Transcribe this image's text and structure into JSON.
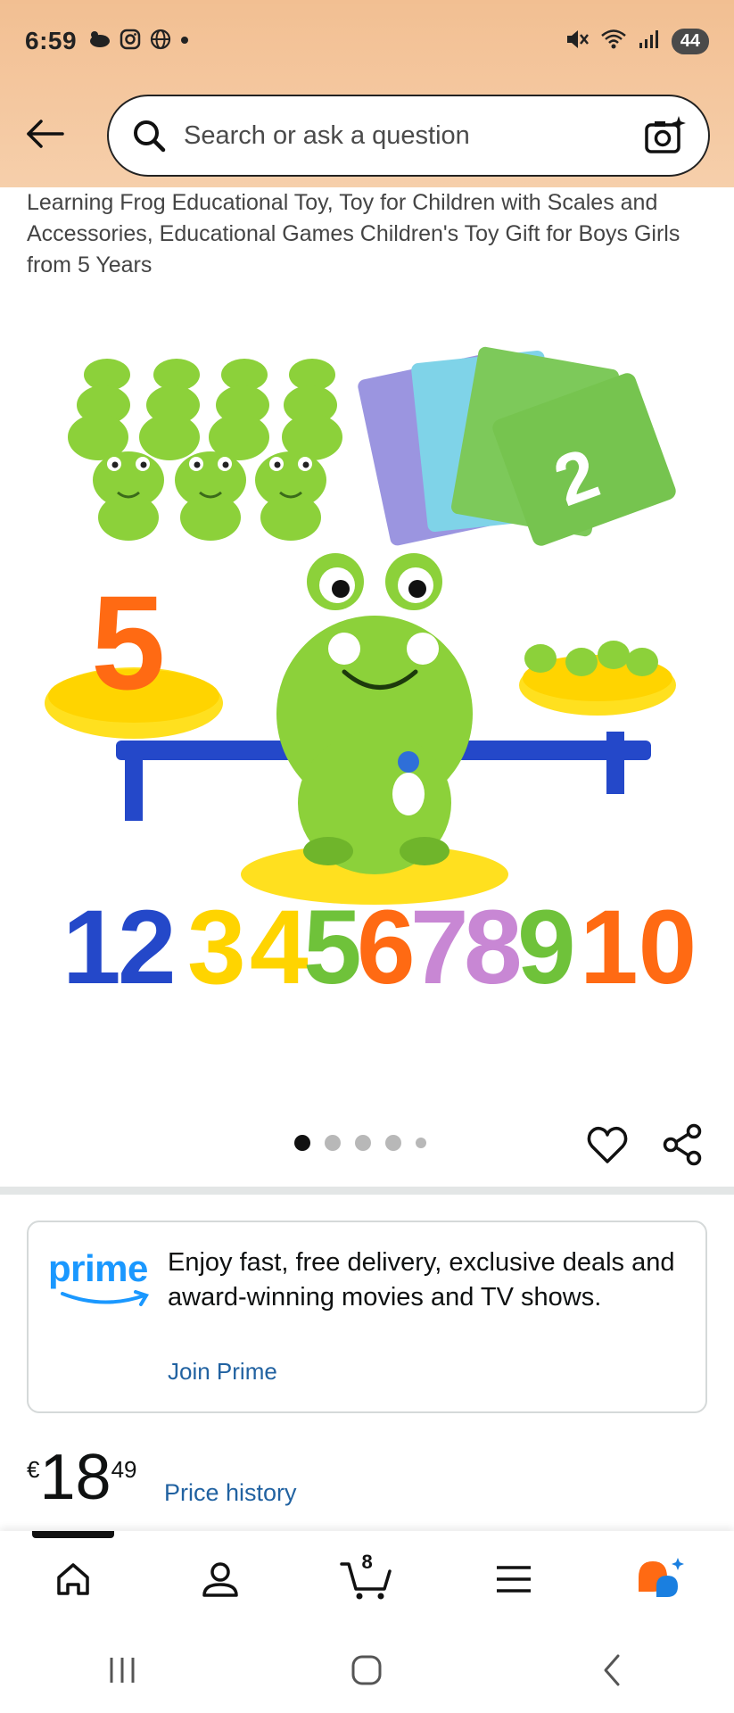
{
  "status_bar": {
    "time": "6:59",
    "battery": "44"
  },
  "search": {
    "placeholder": "Search or ask a question"
  },
  "product": {
    "title": "Learning Frog Educational Toy, Toy for Children with Scales and Accessories, Educational Games Children's Toy Gift for Boys Girls from 5 Years",
    "image_numbers": [
      "1",
      "2",
      "3",
      "4",
      "5",
      "6",
      "7",
      "8",
      "9",
      "10"
    ],
    "card_number": "2",
    "scale_number": "5",
    "image_count": 5,
    "active_image": 1
  },
  "prime": {
    "logo_text": "prime",
    "text": "Enjoy fast, free delivery, exclusive deals and award-winning movies and TV shows.",
    "link": "Join Prime"
  },
  "price": {
    "currency": "€",
    "whole": "18",
    "fraction": "49",
    "history_link": "Price history"
  },
  "nav": {
    "cart_count": "8"
  },
  "colors": {
    "header_bg": "#f5c9a3",
    "link": "#2162a1",
    "prime_blue": "#1a98ff",
    "frog_green": "#8cd13a"
  }
}
